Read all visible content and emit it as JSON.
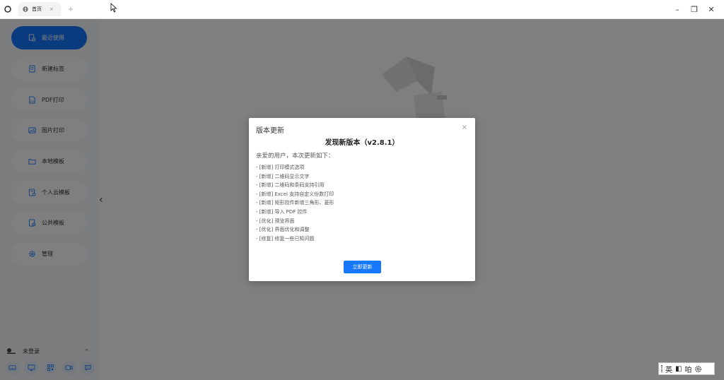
{
  "titlebar": {
    "tab_label": "首页",
    "tab_close": "×",
    "tab_add": "+",
    "minimize": "–",
    "maximize": "❐",
    "close": "✕"
  },
  "sidebar": {
    "items": [
      {
        "label": "最近使用",
        "icon": "recent-doc-icon",
        "active": true
      },
      {
        "label": "新建标签",
        "icon": "new-label-icon"
      },
      {
        "label": "PDF打印",
        "icon": "pdf-icon"
      },
      {
        "label": "图片打印",
        "icon": "image-icon"
      },
      {
        "label": "本地模板",
        "icon": "folder-icon"
      },
      {
        "label": "个人云模板",
        "icon": "cloud-template-icon"
      },
      {
        "label": "公共模板",
        "icon": "public-template-icon"
      },
      {
        "label": "管理",
        "icon": "gear-icon"
      }
    ],
    "user": {
      "label": "未登录",
      "chevron": "^"
    },
    "tools": [
      "keyboard-icon",
      "monitor-icon",
      "qrcode-icon",
      "video-icon",
      "chat-icon"
    ]
  },
  "main": {
    "collapse_arrow": "‹"
  },
  "modal": {
    "title": "版本更新",
    "close": "×",
    "heading": "发现新版本（v2.8.1）",
    "intro": "亲爱的用户，本次更新如下：",
    "changelog": [
      "- [新增] 打印模式选项",
      "- [新增] 二维码显示文字",
      "- [新增] 二维码和条码支持引用",
      "- [新增] Excel 支持自定义份数打印",
      "- [新增] 矩形控件新增三角形、菱形",
      "- [新增] 导入 PDF 控件",
      "- [优化] 预览界面",
      "- [优化] 界面优化和调整",
      "- [修复] 修复一些已知问题"
    ],
    "button_label": "立即更新"
  },
  "ime": {
    "lang": "英",
    "width_mode": "◧",
    "punct": "㕷"
  },
  "colors": {
    "accent": "#1677ff",
    "overlay": "rgba(0,0,0,0.5)"
  }
}
